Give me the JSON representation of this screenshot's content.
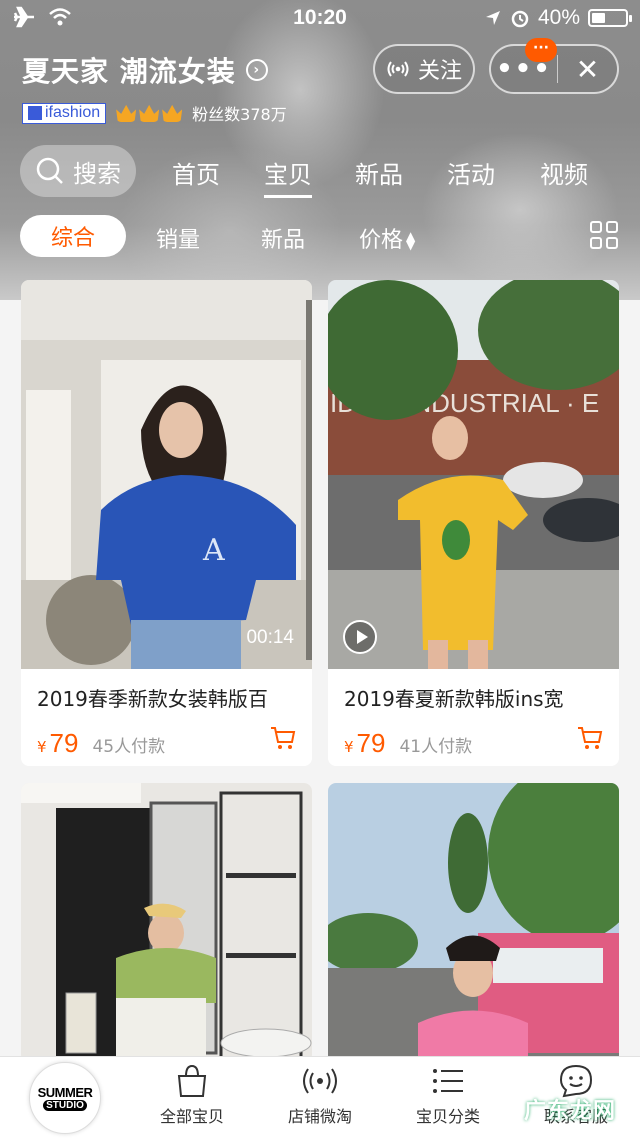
{
  "status_bar": {
    "time": "10:20",
    "battery": "40%",
    "battery_level": 0.4
  },
  "header": {
    "store_name": "夏天家 潮流女装",
    "follow_label": "关注",
    "notification_badge": "···",
    "brand_tag": "ifashion",
    "crown_count": 3,
    "fans": "粉丝数378万"
  },
  "nav": {
    "search_label": "搜索",
    "tabs": [
      "首页",
      "宝贝",
      "新品",
      "活动",
      "视频"
    ],
    "active_tab": "宝贝"
  },
  "filters": {
    "items": [
      "综合",
      "销量",
      "新品",
      "价格"
    ],
    "active": "综合"
  },
  "products": [
    {
      "title": "2019春季新款女装韩版百",
      "currency": "¥",
      "price": "79",
      "sold": "45人付款",
      "video_time": "00:14"
    },
    {
      "title": "2019春夏新款韩版ins宽",
      "currency": "¥",
      "price": "79",
      "sold": "41人付款"
    },
    {
      "title": "",
      "currency": "",
      "price": "",
      "sold": ""
    },
    {
      "title": "",
      "currency": "",
      "price": "",
      "sold": ""
    }
  ],
  "tabbar": {
    "logo_line1": "SUMMER",
    "logo_line2": "STUDIO",
    "items": [
      "全部宝贝",
      "店铺微淘",
      "宝贝分类",
      "联系客服"
    ]
  },
  "watermark": "广东龙网",
  "colors": {
    "accent": "#ff5a00",
    "brand_blue": "#3a5bd9",
    "crown": "#f5a623"
  }
}
